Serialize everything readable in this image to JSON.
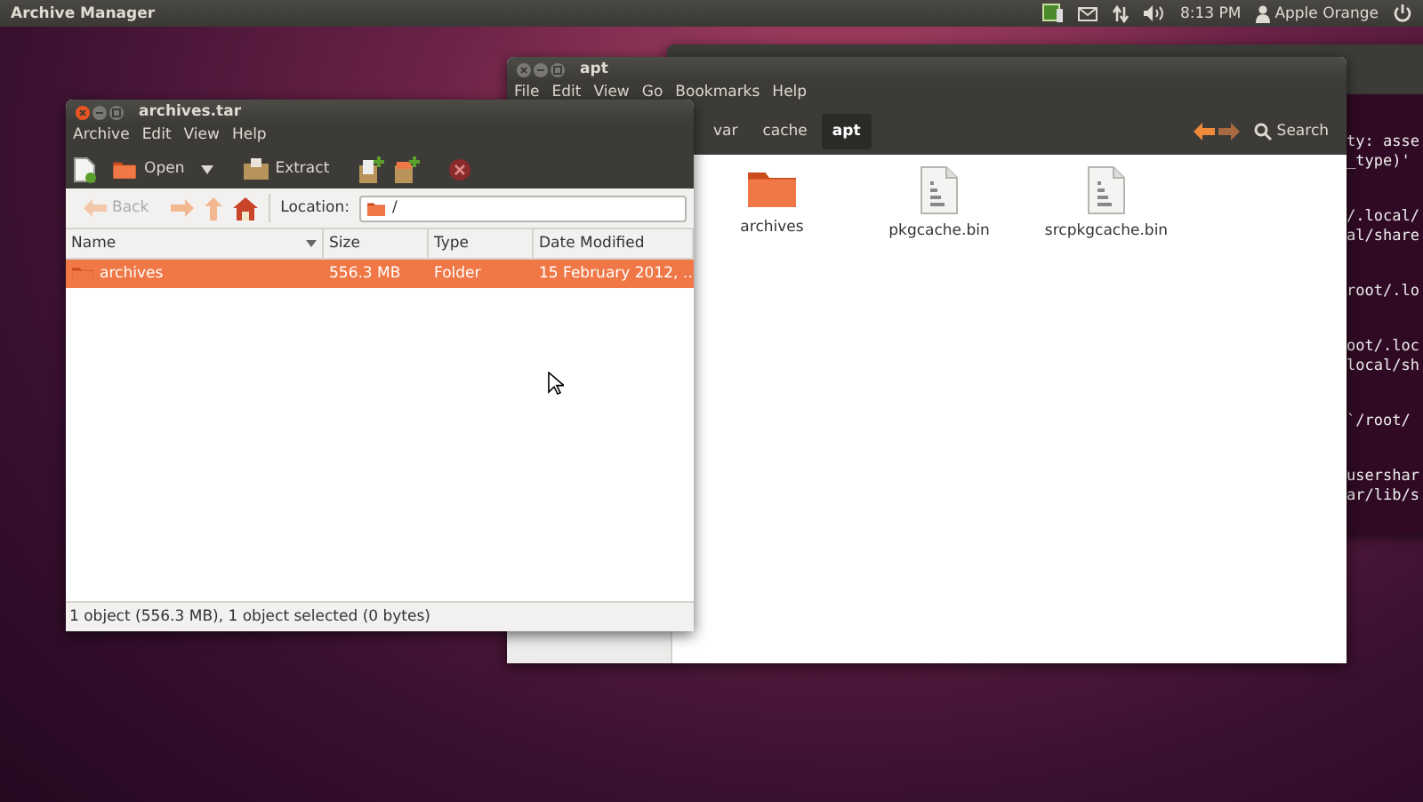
{
  "top_panel": {
    "app_title": "Archive Manager",
    "clock": "8:13 PM",
    "user": "Apple Orange"
  },
  "terminal": {
    "line_groups": [
      [
        "ty: asse",
        "_type)'"
      ],
      [
        "/.local/",
        "al/share"
      ],
      [
        "root/.lo"
      ],
      [
        "oot/.loc",
        "local/sh"
      ],
      [
        "`/root/"
      ],
      [
        "usershar",
        "ar/lib/s"
      ]
    ]
  },
  "file_manager": {
    "title": "apt",
    "menu": [
      "File",
      "Edit",
      "View",
      "Go",
      "Bookmarks",
      "Help"
    ],
    "path": [
      {
        "label": "var",
        "selected": false
      },
      {
        "label": "cache",
        "selected": false
      },
      {
        "label": "apt",
        "selected": true
      }
    ],
    "search": "Search",
    "files": [
      {
        "name": "archives",
        "kind": "folder"
      },
      {
        "name": "pkgcache.bin",
        "kind": "binary"
      },
      {
        "name": "srcpkgcache.bin",
        "kind": "binary"
      }
    ]
  },
  "archive_manager": {
    "title": "archives.tar",
    "menu": [
      "Archive",
      "Edit",
      "View",
      "Help"
    ],
    "toolbar": {
      "open": "Open",
      "extract": "Extract"
    },
    "navigation": {
      "back": "Back",
      "back_disabled": true,
      "location_label": "Location:",
      "location": "/"
    },
    "columns": [
      "Name",
      "Size",
      "Type",
      "Date Modified"
    ],
    "rows": [
      {
        "name": "archives",
        "size": "556.3 MB",
        "type": "Folder",
        "date_modified": "15 February 2012, …",
        "selected": true
      }
    ],
    "status_bar": "1 object (556.3 MB), 1 object selected (0 bytes)"
  }
}
